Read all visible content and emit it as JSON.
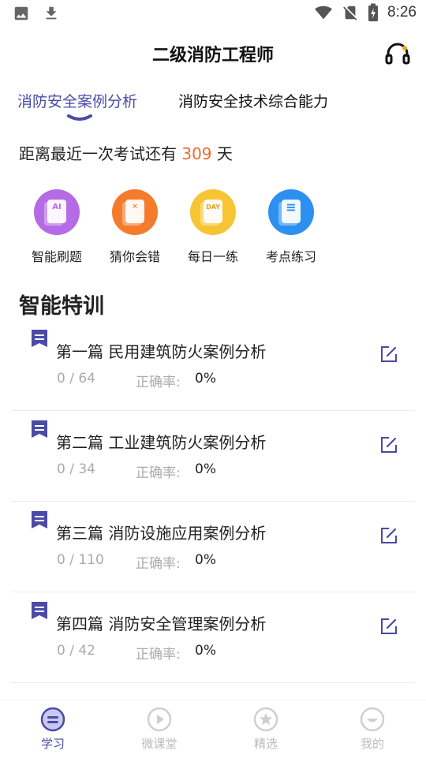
{
  "status_bar": {
    "time": "8:26",
    "icons": [
      "image-icon",
      "download-icon",
      "wifi-icon",
      "no-sim-icon",
      "battery-charging-icon"
    ]
  },
  "header": {
    "title": "二级消防工程师",
    "right_icon": "headset-icon"
  },
  "tabs": [
    {
      "label": "消防安全案例分析",
      "active": true
    },
    {
      "label": "消防安全技术综合能力",
      "active": false
    }
  ],
  "countdown": {
    "prefix": "距离最近一次考试还有",
    "days": "309",
    "suffix": "天"
  },
  "quick_actions": [
    {
      "label": "智能刷题",
      "icon": "ai-practice-icon",
      "glyph": "AI",
      "color": "#b56ae6"
    },
    {
      "label": "猜你会错",
      "icon": "wrong-guess-icon",
      "glyph": "✕",
      "color": "#f47b2b"
    },
    {
      "label": "每日一练",
      "icon": "daily-practice-icon",
      "glyph": "DAY",
      "color": "#f7c533"
    },
    {
      "label": "考点练习",
      "icon": "exam-point-icon",
      "glyph": "≡",
      "color": "#2d8ff0"
    }
  ],
  "section_title": "智能特训",
  "courses": [
    {
      "name": "第一篇 民用建筑防火案例分析",
      "progress": "0 / 64",
      "accuracy_label": "正确率:",
      "accuracy": "0%"
    },
    {
      "name": "第二篇 工业建筑防火案例分析",
      "progress": "0 / 34",
      "accuracy_label": "正确率:",
      "accuracy": "0%"
    },
    {
      "name": "第三篇 消防设施应用案例分析",
      "progress": "0 / 110",
      "accuracy_label": "正确率:",
      "accuracy": "0%"
    },
    {
      "name": "第四篇 消防安全管理案例分析",
      "progress": "0 / 42",
      "accuracy_label": "正确率:",
      "accuracy": "0%"
    }
  ],
  "bottom_nav": [
    {
      "label": "学习",
      "icon": "study-icon",
      "active": true
    },
    {
      "label": "微课堂",
      "icon": "micro-class-icon",
      "active": false
    },
    {
      "label": "精选",
      "icon": "featured-icon",
      "active": false
    },
    {
      "label": "我的",
      "icon": "profile-icon",
      "active": false
    }
  ],
  "colors": {
    "accent": "#4a4aa8",
    "countdown_number": "#ee6a2c",
    "muted_text": "#aaaaaa"
  }
}
